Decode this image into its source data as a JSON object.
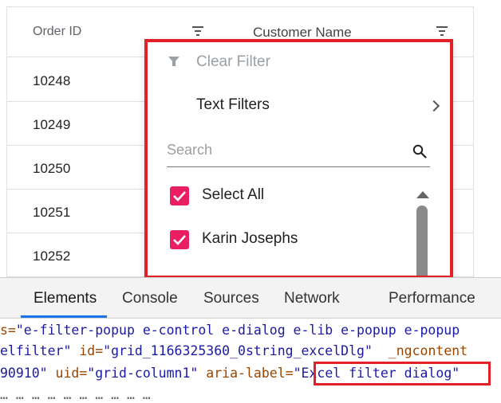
{
  "grid": {
    "columns": [
      {
        "label": "Order ID"
      },
      {
        "label": "Customer Name"
      }
    ],
    "rows": [
      "10248",
      "10249",
      "10250",
      "10251",
      "10252"
    ]
  },
  "filter_popup": {
    "clear_filter": "Clear Filter",
    "text_filters": "Text Filters",
    "search_placeholder": "Search",
    "items": [
      {
        "label": "Select All",
        "checked": true
      },
      {
        "label": "Karin Josephs",
        "checked": true
      }
    ],
    "checkbox_color": "#e91e63",
    "highlight_color": "#e3202a"
  },
  "devtools": {
    "tabs": [
      "Elements",
      "Console",
      "Sources",
      "Network",
      "Performance"
    ],
    "active_tab": "Elements",
    "code": {
      "l1_attr": "s=",
      "l1_val": "\"e-filter-popup e-control e-dialog e-lib e-popup e-popup",
      "l2_val": "elfilter\"",
      "l2_attr": " id=",
      "l2_val2": "\"grid_1166325360_0string_excelDlg\"",
      "l2_attr2": "  _ngcontent",
      "l3_val": "90910\"",
      "l3_attr": " uid=",
      "l3_val2": "\"grid-column1\"",
      "l3_attr2": " aria-label=",
      "l3_val3": "\"Excel filter dialog\"",
      "l4_text": "… … … … … … … … … …"
    }
  }
}
